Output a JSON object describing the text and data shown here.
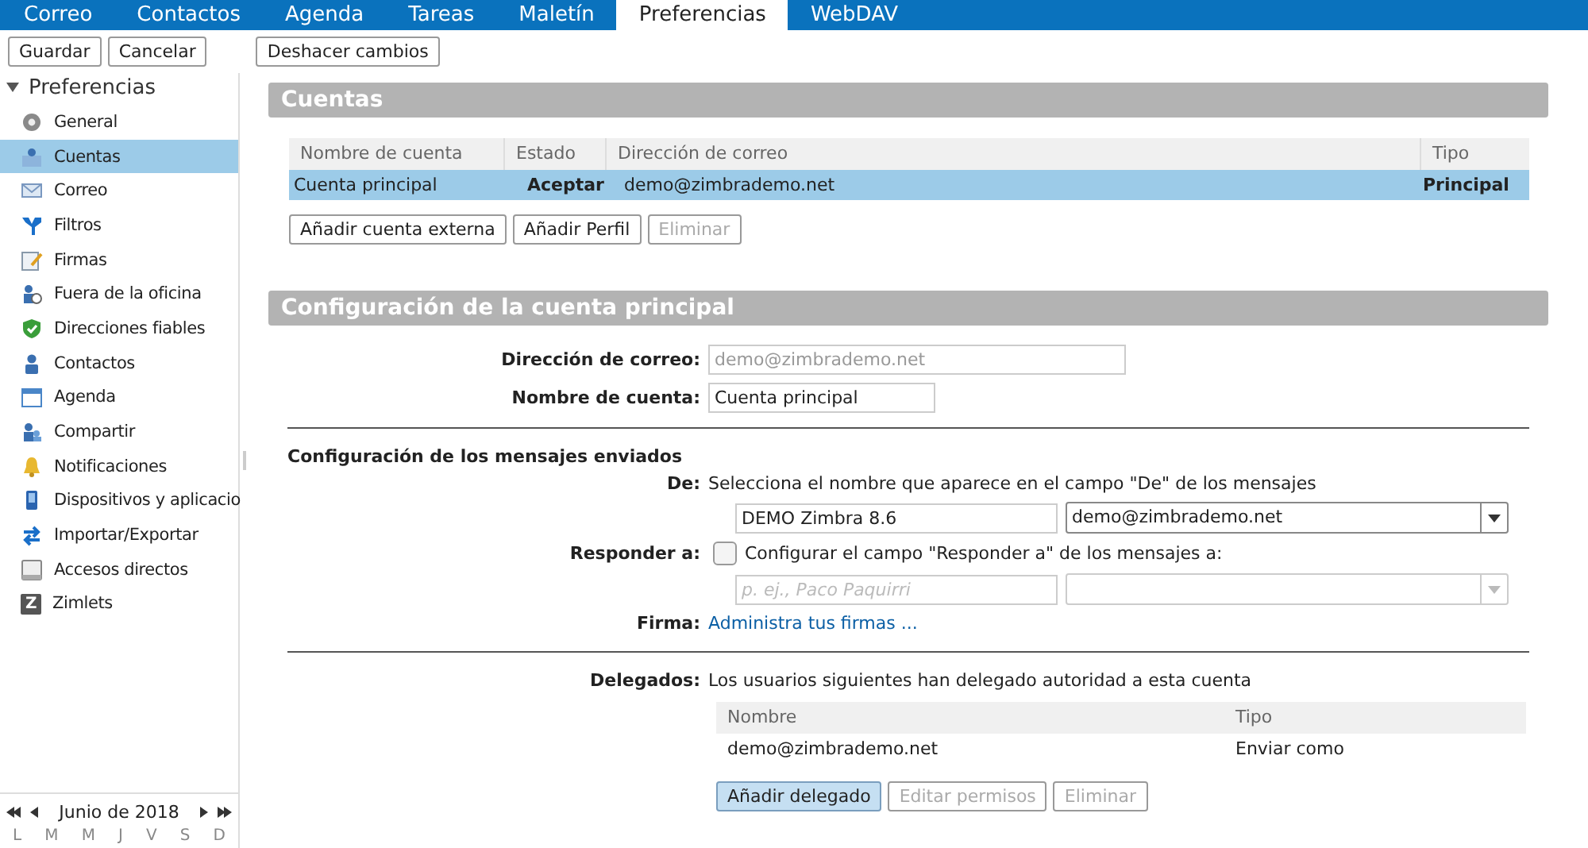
{
  "tabs": [
    {
      "label": "Correo",
      "selected": false
    },
    {
      "label": "Contactos",
      "selected": false
    },
    {
      "label": "Agenda",
      "selected": false
    },
    {
      "label": "Tareas",
      "selected": false
    },
    {
      "label": "Maletín",
      "selected": false
    },
    {
      "label": "Preferencias",
      "selected": true
    },
    {
      "label": "WebDAV",
      "selected": false
    }
  ],
  "toolbar": {
    "buttons": [
      "Guardar",
      "Cancelar"
    ],
    "undo": "Deshacer cambios"
  },
  "sidebar": {
    "title": "Preferencias",
    "expanded": true,
    "items": [
      {
        "label": "General",
        "selected": false
      },
      {
        "label": "Cuentas",
        "selected": true
      },
      {
        "label": "Correo",
        "selected": false
      },
      {
        "label": "Filtros",
        "selected": false
      },
      {
        "label": "Firmas",
        "selected": false
      },
      {
        "label": "Fuera de la oficina",
        "selected": false
      },
      {
        "label": "Direcciones fiables",
        "selected": false
      },
      {
        "label": "Contactos",
        "selected": false
      },
      {
        "label": "Agenda",
        "selected": false
      },
      {
        "label": "Compartir",
        "selected": false
      },
      {
        "label": "Notificaciones",
        "selected": false
      },
      {
        "label": "Dispositivos y aplicacio",
        "selected": false
      },
      {
        "label": "Importar/Exportar",
        "selected": false
      },
      {
        "label": "Accesos directos",
        "selected": false
      },
      {
        "label": "Zimlets",
        "selected": false,
        "badge": "Z"
      }
    ]
  },
  "mini_calendar": {
    "month": "Junio de 2018",
    "weekdays": [
      "L",
      "M",
      "M",
      "J",
      "V",
      "S",
      "D"
    ]
  },
  "accounts": {
    "title": "Cuentas",
    "columns": [
      "Nombre de cuenta",
      "Estado",
      "Dirección de correo",
      "Tipo"
    ],
    "rows": [
      {
        "name": "Cuenta principal",
        "status": "Aceptar",
        "email": "demo@zimbrademo.net",
        "type": "Principal",
        "selected": true
      }
    ],
    "buttons": [
      {
        "label": "Añadir cuenta externa",
        "disabled": false
      },
      {
        "label": "Añadir Perfil",
        "disabled": false
      },
      {
        "label": "Eliminar",
        "disabled": true
      }
    ]
  },
  "config": {
    "title": "Configuración de la cuenta principal",
    "email_label": "Dirección de correo:",
    "email_value": "demo@zimbrademo.net",
    "name_label": "Nombre de cuenta:",
    "name_value": "Cuenta principal",
    "sent_title": "Configuración de los mensajes enviados",
    "from_label": "De:",
    "from_hint": "Selecciona el nombre que aparece en el campo \"De\" de los mensajes",
    "from_name": "DEMO Zimbra 8.6",
    "from_email": "demo@zimbrademo.net",
    "reply_label": "Responder a:",
    "reply_checked": false,
    "reply_text": "Configurar el campo \"Responder a\" de los mensajes a:",
    "reply_placeholder": "p. ej., Paco Paquirri",
    "signature_label": "Firma:",
    "signature_link": "Administra tus firmas ...",
    "delegates_label": "Delegados:",
    "delegates_text": "Los usuarios siguientes han delegado autoridad a esta cuenta",
    "delegate_columns": [
      "Nombre",
      "Tipo"
    ],
    "delegate_rows": [
      {
        "name": "demo@zimbrademo.net",
        "type": "Enviar como"
      }
    ],
    "delegate_buttons": [
      {
        "label": "Añadir delegado",
        "disabled": false,
        "selected": true
      },
      {
        "label": "Editar permisos",
        "disabled": true,
        "selected": false
      },
      {
        "label": "Eliminar",
        "disabled": true,
        "selected": false
      }
    ]
  }
}
